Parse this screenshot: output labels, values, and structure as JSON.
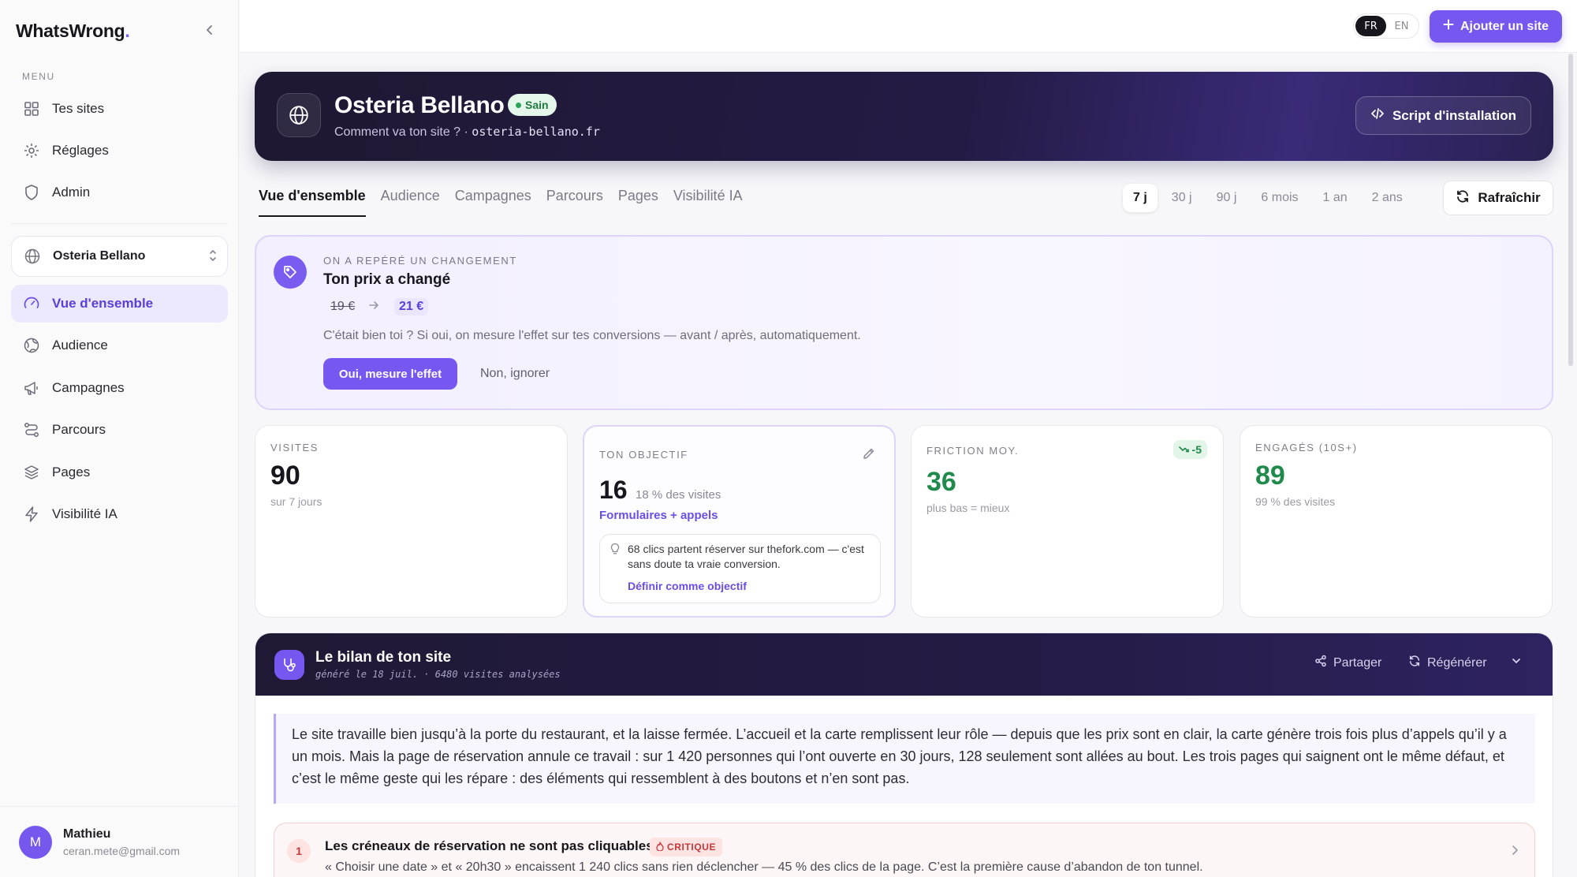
{
  "sidebar": {
    "logo": "WhatsWrong",
    "logo_dot": ".",
    "menu_label": "MENU",
    "top_items": [
      {
        "label": "Tes sites"
      },
      {
        "label": "Réglages"
      },
      {
        "label": "Admin"
      }
    ],
    "site_selector": "Osteria Bellano",
    "site_items": [
      {
        "label": "Vue d'ensemble",
        "active": true
      },
      {
        "label": "Audience"
      },
      {
        "label": "Campagnes"
      },
      {
        "label": "Parcours"
      },
      {
        "label": "Pages"
      },
      {
        "label": "Visibilité IA"
      }
    ],
    "user": {
      "initial": "M",
      "name": "Mathieu",
      "email": "ceran.mete@gmail.com"
    }
  },
  "topbar": {
    "lang_options": [
      "FR",
      "EN"
    ],
    "lang_selected": "FR",
    "add_site": "Ajouter un site"
  },
  "hero": {
    "site_name": "Osteria Bellano",
    "status": "Sain",
    "subtitle": "Comment va ton site ? · ",
    "domain": "osteria-bellano.fr",
    "script_button": "Script d'installation"
  },
  "tabs": [
    "Vue d'ensemble",
    "Audience",
    "Campagnes",
    "Parcours",
    "Pages",
    "Visibilité IA"
  ],
  "ranges": [
    "7 j",
    "30 j",
    "90 j",
    "6 mois",
    "1 an",
    "2 ans"
  ],
  "range_selected": "7 j",
  "refresh": "Rafraîchir",
  "alert": {
    "eyebrow": "ON A REPÉRÉ UN CHANGEMENT",
    "title": "Ton prix a changé",
    "old_price": "19 €",
    "new_price": "21 €",
    "description": "C'était bien toi ? Si oui, on mesure l'effet sur tes conversions — avant / après, automatiquement.",
    "yes": "Oui, mesure l'effet",
    "no": "Non, ignorer"
  },
  "kpis": {
    "visits": {
      "label": "VISITES",
      "value": "90",
      "sub": "sur 7 jours"
    },
    "goal": {
      "label": "TON OBJECTIF",
      "value": "16",
      "pct": "18 % des visites",
      "link": "Formulaires + appels",
      "tip": "68 clics partent réserver sur thefork.com — c'est sans doute ta vraie conversion.",
      "tip_action": "Définir comme objectif"
    },
    "friction": {
      "label": "FRICTION MOY.",
      "value": "36",
      "sub": "plus bas = mieux",
      "trend": "-5"
    },
    "engaged": {
      "label": "ENGAGÉS (10S+)",
      "value": "89",
      "sub": "99 % des visites"
    }
  },
  "report": {
    "title": "Le bilan de ton site",
    "meta": "généré le 18 juil. · 6480 visites analysées",
    "share": "Partager",
    "regenerate": "Régénérer",
    "summary": "Le site travaille bien jusqu’à la porte du restaurant, et la laisse fermée. L’accueil et la carte remplissent leur rôle — depuis que les prix sont en clair, la carte génère trois fois plus d’appels qu’il y a un mois. Mais la page de réservation annule ce travail : sur 1 420 personnes qui l’ont ouverte en 30 jours, 128 seulement sont allées au bout. Les trois pages qui saignent ont le même défaut, et c’est le même geste qui les répare : des éléments qui ressemblent à des boutons et n’en sont pas.",
    "issue": {
      "number": "1",
      "title": "Les créneaux de réservation ne sont pas cliquables",
      "severity": "CRITIQUE",
      "description": "« Choisir une date » et « 20h30 » encaissent 1 240 clics sans rien déclencher — 45 % des clics de la page. C’est la première cause d’abandon de ton tunnel."
    }
  },
  "colors": {
    "accent": "#7657f0",
    "dark": "#1e1832",
    "success": "#1f8a4c",
    "danger": "#c5383b"
  }
}
